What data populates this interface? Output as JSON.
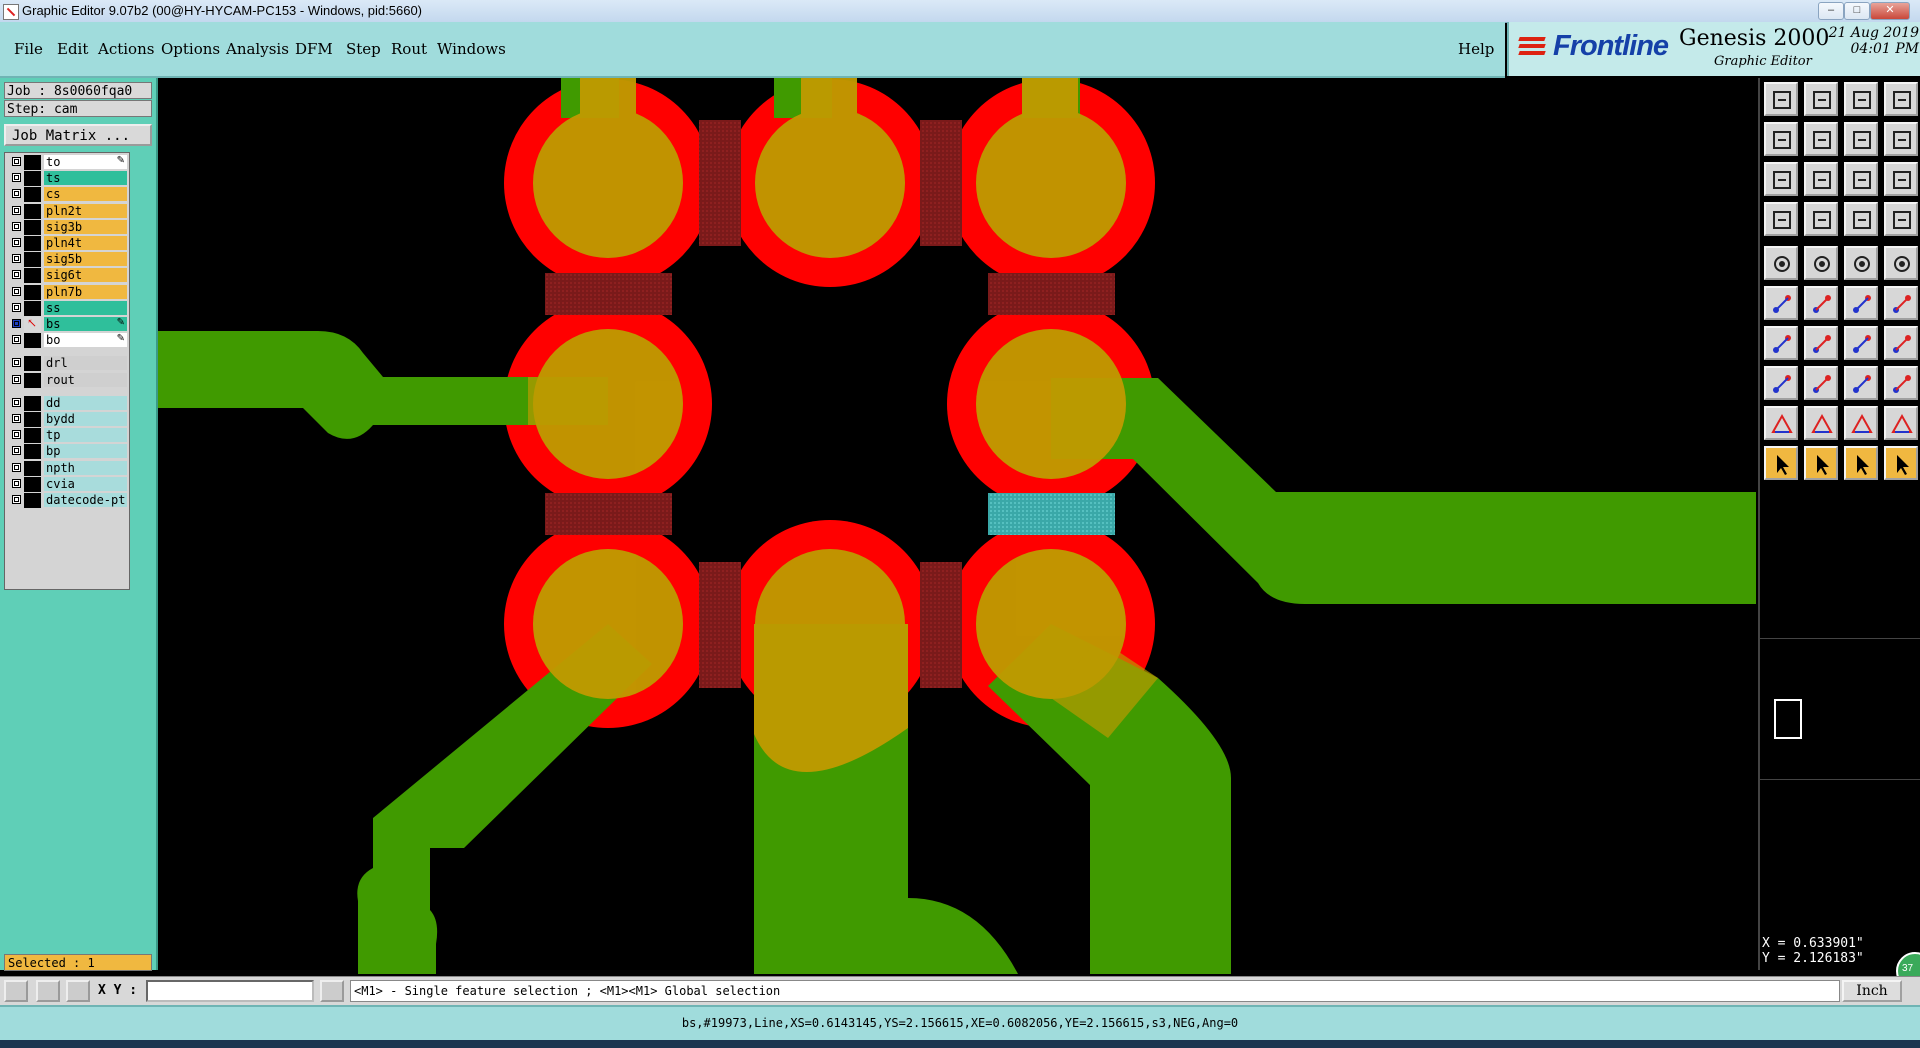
{
  "window": {
    "title": "Graphic Editor 9.07b2 (00@HY-HYCAM-PC153 - Windows, pid:5660)",
    "min": "–",
    "max": "□",
    "close": "✕"
  },
  "menu": {
    "items": [
      "File",
      "Edit",
      "Actions",
      "Options",
      "Analysis",
      "DFM",
      "Step",
      "Rout",
      "Windows"
    ],
    "help": "Help"
  },
  "branding": {
    "logo": "Frontline",
    "product": "Genesis 2000",
    "subtitle": "Graphic Editor",
    "date": "21 Aug 2019",
    "time": "04:01 PM"
  },
  "job": {
    "job_label": "Job : 8s0060fqa0",
    "step_label": "Step: cam",
    "matrix_button": "Job Matrix ...",
    "layers": [
      {
        "name": "to",
        "color": "#ffffff",
        "mark": "✎"
      },
      {
        "name": "ts",
        "color": "#2fbf9b",
        "mark": ""
      },
      {
        "name": "cs",
        "color": "#f0b840",
        "mark": ""
      },
      {
        "name": "pln2t",
        "color": "#f0b840",
        "mark": ""
      },
      {
        "name": "sig3b",
        "color": "#f0b840",
        "mark": ""
      },
      {
        "name": "pln4t",
        "color": "#f0b840",
        "mark": ""
      },
      {
        "name": "sig5b",
        "color": "#f0b840",
        "mark": ""
      },
      {
        "name": "sig6t",
        "color": "#f0b840",
        "mark": ""
      },
      {
        "name": "pln7b",
        "color": "#f0b840",
        "mark": ""
      },
      {
        "name": "ss",
        "color": "#2fbf9b",
        "mark": ""
      },
      {
        "name": "bs",
        "color": "#2fbf9b",
        "mark": "✎",
        "active": true
      },
      {
        "name": "bo",
        "color": "#ffffff",
        "mark": "✎"
      },
      {
        "name": "drl",
        "color": "#cfcfcf",
        "mark": ""
      },
      {
        "name": "rout",
        "color": "#cfcfcf",
        "mark": ""
      },
      {
        "name": "dd",
        "color": "#a8dcdc",
        "mark": ""
      },
      {
        "name": "bydd",
        "color": "#a8dcdc",
        "mark": ""
      },
      {
        "name": "tp",
        "color": "#a8dcdc",
        "mark": ""
      },
      {
        "name": "bp",
        "color": "#a8dcdc",
        "mark": ""
      },
      {
        "name": "npth",
        "color": "#a8dcdc",
        "mark": ""
      },
      {
        "name": "cvia",
        "color": "#a8dcdc",
        "mark": ""
      },
      {
        "name": "datecode-pt",
        "color": "#a8dcdc",
        "mark": ""
      }
    ],
    "selected": "Selected : 1"
  },
  "toolbar": {
    "tools": [
      "layer-up-icon",
      "layer-down-icon",
      "home-icon",
      "layout-icon",
      "step-left-icon",
      "step-right-icon",
      "pan-left-icon",
      "pan-right-icon",
      "zoom-fit-icon",
      "zoom-move-icon",
      "zoom-1to2-icon",
      "help-icon",
      "snap-icon",
      "grid-icon",
      "profile-icon",
      "datum-icon",
      "add-pad-icon",
      "add-surface-icon",
      "measure-icon",
      "pad-icon",
      "move-node-icon",
      "delete-node-icon",
      "connect-icon",
      "break-icon",
      "line-icon",
      "slash-icon",
      "arc-icon",
      "split-icon",
      "pad-edit-icon",
      "dash-icon",
      "bracket-icon",
      "array-icon",
      "triangle-icon",
      "text-a-icon",
      "text-t-icon",
      "text-a2-icon",
      "select-icon",
      "select2-icon",
      "select3-icon",
      "select-route-icon"
    ]
  },
  "coords": {
    "x": "X = 0.633901\"",
    "y": "Y = 2.126183\""
  },
  "command": {
    "xy_label": "X Y :",
    "xy_value": "",
    "hint": "<M1> - Single feature selection ; <M1><M1> Global selection",
    "unit": "Inch"
  },
  "status": {
    "feature": "bs,#19973,Line,XS=0.6143145,YS=2.156615,XE=0.6082056,YE=2.156615,s3,NEG,Ang=0"
  },
  "badge": "37"
}
